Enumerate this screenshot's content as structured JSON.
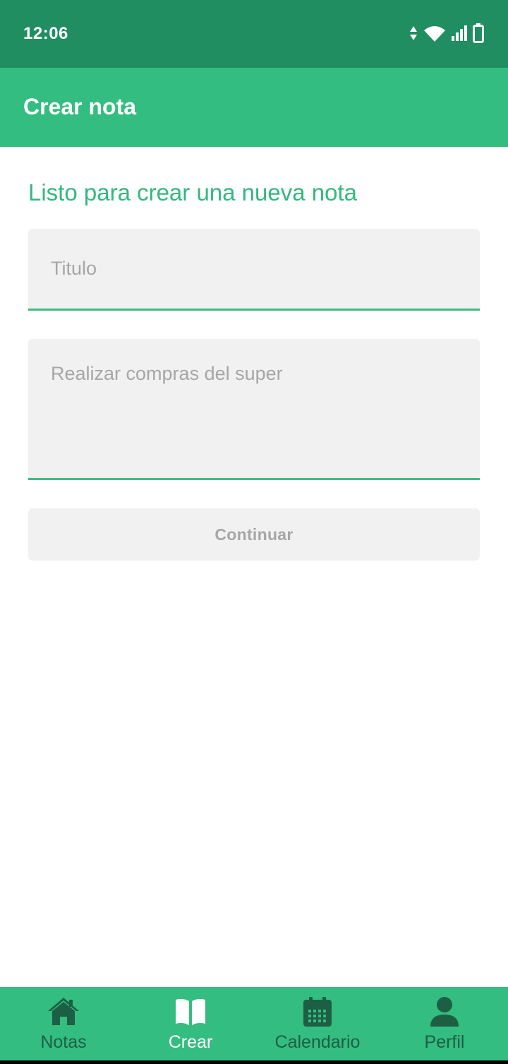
{
  "status_bar": {
    "time": "12:06",
    "icons": [
      "data-arrows-icon",
      "wifi-icon",
      "signal-icon",
      "battery-icon"
    ]
  },
  "app_bar": {
    "title": "Crear nota"
  },
  "main": {
    "heading": "Listo para crear una nueva nota",
    "title_field": {
      "placeholder": "Titulo",
      "value": ""
    },
    "body_field": {
      "placeholder": "Realizar compras del super",
      "value": ""
    },
    "continue_label": "Continuar"
  },
  "bottom_nav": {
    "items": [
      {
        "label": "Notas",
        "icon": "home-icon",
        "active": false
      },
      {
        "label": "Crear",
        "icon": "open-book-icon",
        "active": true
      },
      {
        "label": "Calendario",
        "icon": "calendar-icon",
        "active": false
      },
      {
        "label": "Perfil",
        "icon": "person-icon",
        "active": false
      }
    ]
  },
  "colors": {
    "status_bar": "#218e62",
    "primary": "#34bd80",
    "accent_text": "#34b87f",
    "nav_inactive": "#1d5f45",
    "field_bg": "#f1f1f1",
    "placeholder": "#a6a6a6"
  }
}
